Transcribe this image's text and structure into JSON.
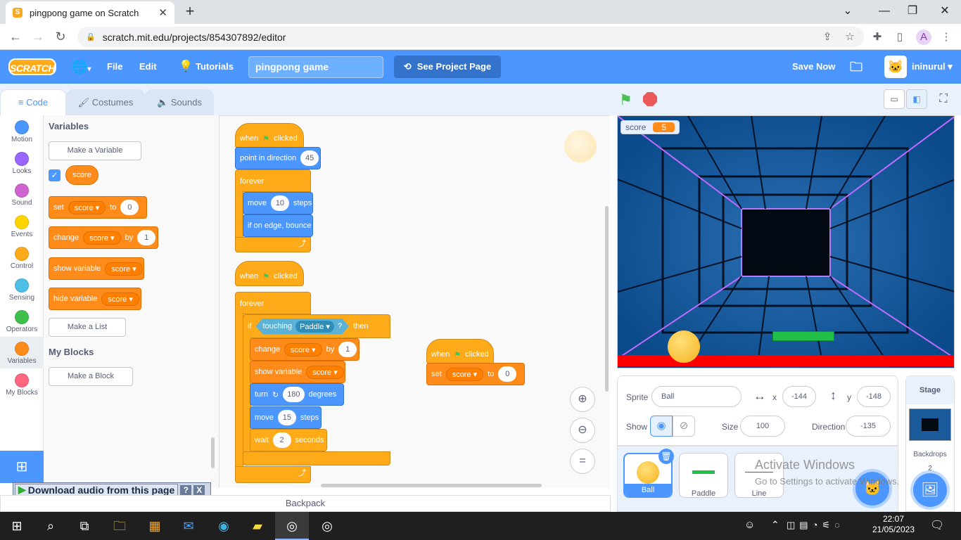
{
  "browser": {
    "tab_title": "pingpong game on Scratch",
    "url": "scratch.mit.edu/projects/854307892/editor"
  },
  "menubar": {
    "logo": "SCRATCH",
    "file": "File",
    "edit": "Edit",
    "tutorials": "Tutorials",
    "project_title": "pingpong game",
    "see_project_page": "See Project Page",
    "save_now": "Save Now",
    "username": "ininurul"
  },
  "tabs": {
    "code": "Code",
    "costumes": "Costumes",
    "sounds": "Sounds"
  },
  "categories": [
    {
      "label": "Motion",
      "color": "#4c97ff"
    },
    {
      "label": "Looks",
      "color": "#9966ff"
    },
    {
      "label": "Sound",
      "color": "#cf63cf"
    },
    {
      "label": "Events",
      "color": "#ffd500"
    },
    {
      "label": "Control",
      "color": "#ffab19"
    },
    {
      "label": "Sensing",
      "color": "#4cbfe6"
    },
    {
      "label": "Operators",
      "color": "#40bf4a"
    },
    {
      "label": "Variables",
      "color": "#ff8c1a"
    },
    {
      "label": "My Blocks",
      "color": "#ff6680"
    }
  ],
  "palette": {
    "variables_title": "Variables",
    "make_variable": "Make a Variable",
    "score_var": "score",
    "set_block": {
      "word": "set",
      "var": "score",
      "to": "to",
      "value": "0"
    },
    "change_block": {
      "word": "change",
      "var": "score",
      "by": "by",
      "value": "1"
    },
    "show_block": {
      "word": "show variable",
      "var": "score"
    },
    "hide_block": {
      "word": "hide variable",
      "var": "score"
    },
    "make_list": "Make a List",
    "myblocks_title": "My Blocks",
    "make_block": "Make a Block"
  },
  "script1": {
    "when": "when",
    "clicked": "clicked",
    "point": "point in direction",
    "point_val": "45",
    "forever": "forever",
    "move": "move",
    "move_val": "10",
    "steps": "steps",
    "bounce": "if on edge, bounce"
  },
  "script2": {
    "when": "when",
    "clicked": "clicked",
    "forever": "forever",
    "if": "if",
    "touching": "touching",
    "touch_target": "Paddle",
    "q": "?",
    "then": "then",
    "change": "change",
    "change_var": "score",
    "by": "by",
    "change_val": "1",
    "show": "show variable",
    "show_var": "score",
    "turn": "turn",
    "turn_val": "180",
    "degrees": "degrees",
    "move": "move",
    "move_val": "15",
    "steps": "steps",
    "wait": "wait",
    "wait_val": "2",
    "seconds": "seconds"
  },
  "script3": {
    "when": "when",
    "clicked": "clicked",
    "set": "set",
    "var": "score",
    "to": "to",
    "value": "0"
  },
  "stage": {
    "score_label": "score",
    "score_value": "5"
  },
  "sprite_info": {
    "sprite_label": "Sprite",
    "sprite_name": "Ball",
    "x_label": "x",
    "x_value": "-144",
    "y_label": "y",
    "y_value": "-148",
    "show_label": "Show",
    "size_label": "Size",
    "size_value": "100",
    "direction_label": "Direction",
    "direction_value": "-135"
  },
  "sprites": [
    "Ball",
    "Paddle",
    "Line"
  ],
  "stage_pane": {
    "title": "Stage",
    "backdrops_label": "Backdrops",
    "backdrops_count": "2"
  },
  "watermark": {
    "line1": "Activate Windows",
    "line2": "Go to Settings to activate Windows."
  },
  "download_bar": {
    "label": "Download audio from this page",
    "help": "?",
    "close": "X"
  },
  "backpack": "Backpack",
  "taskbar": {
    "time": "22:07",
    "date": "21/05/2023"
  }
}
